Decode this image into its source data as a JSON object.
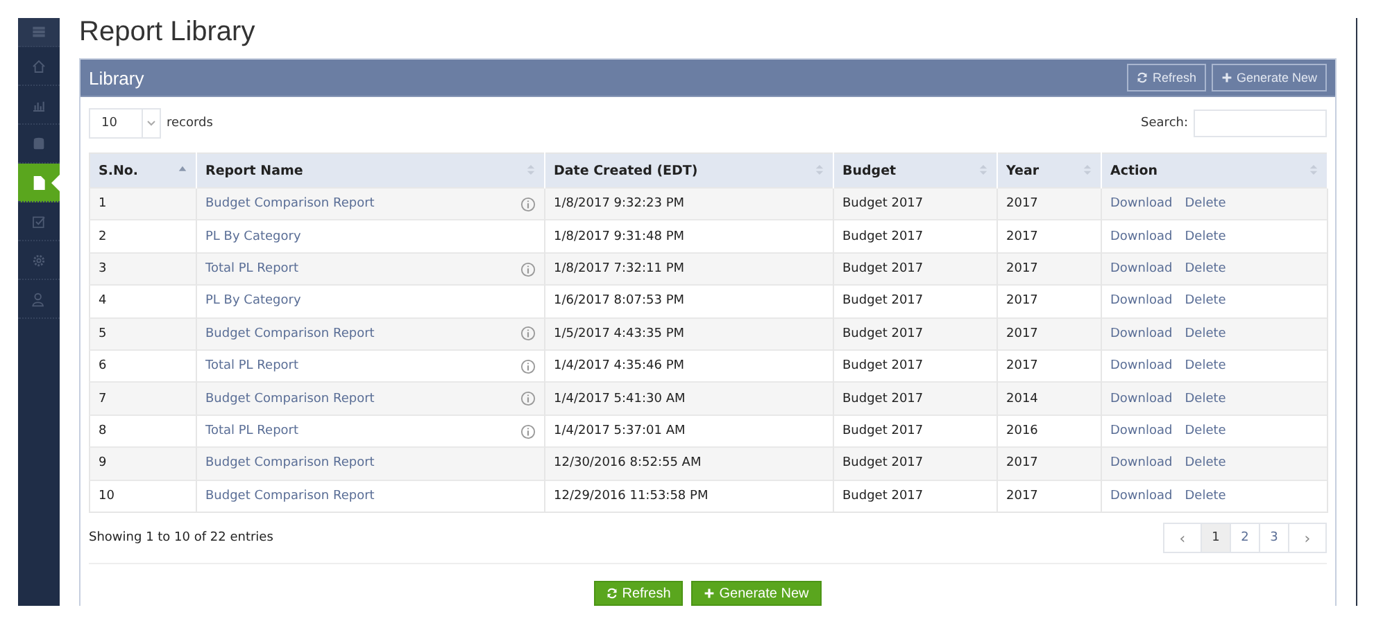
{
  "sidebar": {
    "items": [
      {
        "kind": "menu",
        "selected": false
      },
      {
        "kind": "home",
        "selected": false
      },
      {
        "kind": "chart",
        "selected": false
      },
      {
        "kind": "database",
        "selected": false
      },
      {
        "kind": "file",
        "selected": true
      },
      {
        "kind": "check",
        "selected": false
      },
      {
        "kind": "gear",
        "selected": false
      },
      {
        "kind": "user",
        "selected": false
      }
    ]
  },
  "page_title": "Report Library",
  "panel": {
    "title": "Library",
    "buttons": [
      {
        "kind": "refresh",
        "label": "Refresh"
      },
      {
        "kind": "add",
        "label": "Generate New"
      }
    ]
  },
  "length": {
    "value": "10",
    "label": "records"
  },
  "search": {
    "label": "Search:"
  },
  "table": {
    "columns": [
      {
        "label": "S.No.",
        "sorted": true
      },
      {
        "label": "Report Name",
        "sorted": false
      },
      {
        "label": "Date Created (EDT)",
        "sorted": false
      },
      {
        "label": "Budget",
        "sorted": false
      },
      {
        "label": "Year",
        "sorted": false
      },
      {
        "label": "Action",
        "sorted": false
      }
    ],
    "rows": [
      {
        "no": "1",
        "name": "Budget Comparison Report",
        "info": true,
        "date": "1/8/2017 9:32:23 PM",
        "budget": "Budget 2017",
        "year": "2017",
        "actions": [
          "Download",
          "Delete"
        ]
      },
      {
        "no": "2",
        "name": "PL By Category",
        "info": false,
        "date": "1/8/2017 9:31:48 PM",
        "budget": "Budget 2017",
        "year": "2017",
        "actions": [
          "Download",
          "Delete"
        ]
      },
      {
        "no": "3",
        "name": "Total PL Report",
        "info": true,
        "date": "1/8/2017 7:32:11 PM",
        "budget": "Budget 2017",
        "year": "2017",
        "actions": [
          "Download",
          "Delete"
        ]
      },
      {
        "no": "4",
        "name": "PL By Category",
        "info": false,
        "date": "1/6/2017 8:07:53 PM",
        "budget": "Budget 2017",
        "year": "2017",
        "actions": [
          "Download",
          "Delete"
        ]
      },
      {
        "no": "5",
        "name": "Budget Comparison Report",
        "info": true,
        "date": "1/5/2017 4:43:35 PM",
        "budget": "Budget 2017",
        "year": "2017",
        "actions": [
          "Download",
          "Delete"
        ]
      },
      {
        "no": "6",
        "name": "Total PL Report",
        "info": true,
        "date": "1/4/2017 4:35:46 PM",
        "budget": "Budget 2017",
        "year": "2017",
        "actions": [
          "Download",
          "Delete"
        ]
      },
      {
        "no": "7",
        "name": "Budget Comparison Report",
        "info": true,
        "date": "1/4/2017 5:41:30 AM",
        "budget": "Budget 2017",
        "year": "2014",
        "actions": [
          "Download",
          "Delete"
        ]
      },
      {
        "no": "8",
        "name": "Total PL Report",
        "info": true,
        "date": "1/4/2017 5:37:01 AM",
        "budget": "Budget 2017",
        "year": "2016",
        "actions": [
          "Download",
          "Delete"
        ]
      },
      {
        "no": "9",
        "name": "Budget Comparison Report",
        "info": false,
        "date": "12/30/2016 8:52:55 AM",
        "budget": "Budget 2017",
        "year": "2017",
        "actions": [
          "Download",
          "Delete"
        ]
      },
      {
        "no": "10",
        "name": "Budget Comparison Report",
        "info": false,
        "date": "12/29/2016 11:53:58 PM",
        "budget": "Budget 2017",
        "year": "2017",
        "actions": [
          "Download",
          "Delete"
        ]
      }
    ]
  },
  "info_text": "Showing 1 to 10 of 22 entries",
  "pagination": [
    {
      "kind": "prev",
      "label": "‹",
      "selected": false
    },
    {
      "kind": "page",
      "label": "1",
      "selected": true
    },
    {
      "kind": "page",
      "label": "2",
      "selected": false
    },
    {
      "kind": "page",
      "label": "3",
      "selected": false
    },
    {
      "kind": "next",
      "label": "›",
      "selected": false
    }
  ],
  "footer_buttons": [
    {
      "kind": "refresh",
      "label": "Refresh"
    },
    {
      "kind": "add",
      "label": "Generate New"
    }
  ]
}
